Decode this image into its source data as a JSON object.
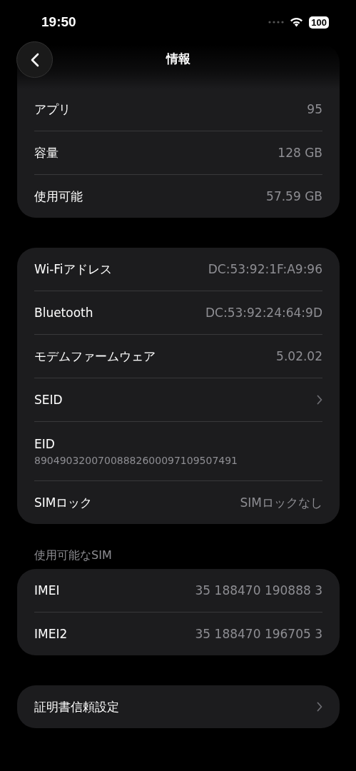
{
  "status_bar": {
    "time": "19:50",
    "battery": "100"
  },
  "nav": {
    "title": "情報"
  },
  "groups": [
    {
      "rows": [
        {
          "kind": "value",
          "label": "アプリ",
          "value": "95"
        },
        {
          "kind": "value",
          "label": "容量",
          "value": "128 GB"
        },
        {
          "kind": "value",
          "label": "使用可能",
          "value": "57.59 GB"
        }
      ]
    },
    {
      "rows": [
        {
          "kind": "value",
          "label": "Wi-Fiアドレス",
          "value": "DC:53:92:1F:A9:96"
        },
        {
          "kind": "value",
          "label": "Bluetooth",
          "value": "DC:53:92:24:64:9D"
        },
        {
          "kind": "value",
          "label": "モデムファームウェア",
          "value": "5.02.02"
        },
        {
          "kind": "link",
          "label": "SEID"
        },
        {
          "kind": "stacked",
          "label": "EID",
          "value": "89049032007008882600097109507491"
        },
        {
          "kind": "value",
          "label": "SIMロック",
          "value": "SIMロックなし"
        }
      ]
    },
    {
      "header": "使用可能なSIM",
      "rows": [
        {
          "kind": "value",
          "label": "IMEI",
          "value": "35 188470 190888 3"
        },
        {
          "kind": "value",
          "label": "IMEI2",
          "value": "35 188470 196705 3"
        }
      ]
    },
    {
      "rows": [
        {
          "kind": "link",
          "label": "証明書信頼設定"
        }
      ]
    }
  ]
}
